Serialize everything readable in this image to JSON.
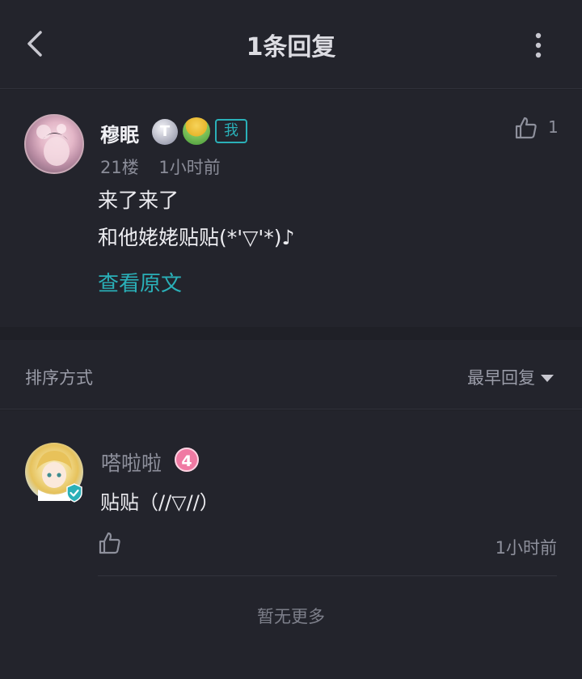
{
  "header": {
    "title": "1条回复",
    "back_icon": "chevron-left-icon",
    "more_icon": "more-vertical-icon"
  },
  "post": {
    "author": "穆眠",
    "badge_t": "T",
    "badge_me": "我",
    "floor": "21楼",
    "time": "1小时前",
    "likes": "1",
    "lines": [
      "来了来了",
      "和他姥姥贴贴(*'▽'*)♪"
    ],
    "view_original": "查看原文"
  },
  "sort": {
    "label": "排序方式",
    "value": "最早回复"
  },
  "reply": {
    "author": "嗒啦啦",
    "level": "4",
    "text": "贴贴（//▽//）",
    "time": "1小时前"
  },
  "footer": {
    "no_more": "暂无更多"
  },
  "colors": {
    "accent": "#2ab0b8",
    "level_badge": "#f07aa3",
    "background": "#1f2027",
    "panel": "#23242c"
  }
}
